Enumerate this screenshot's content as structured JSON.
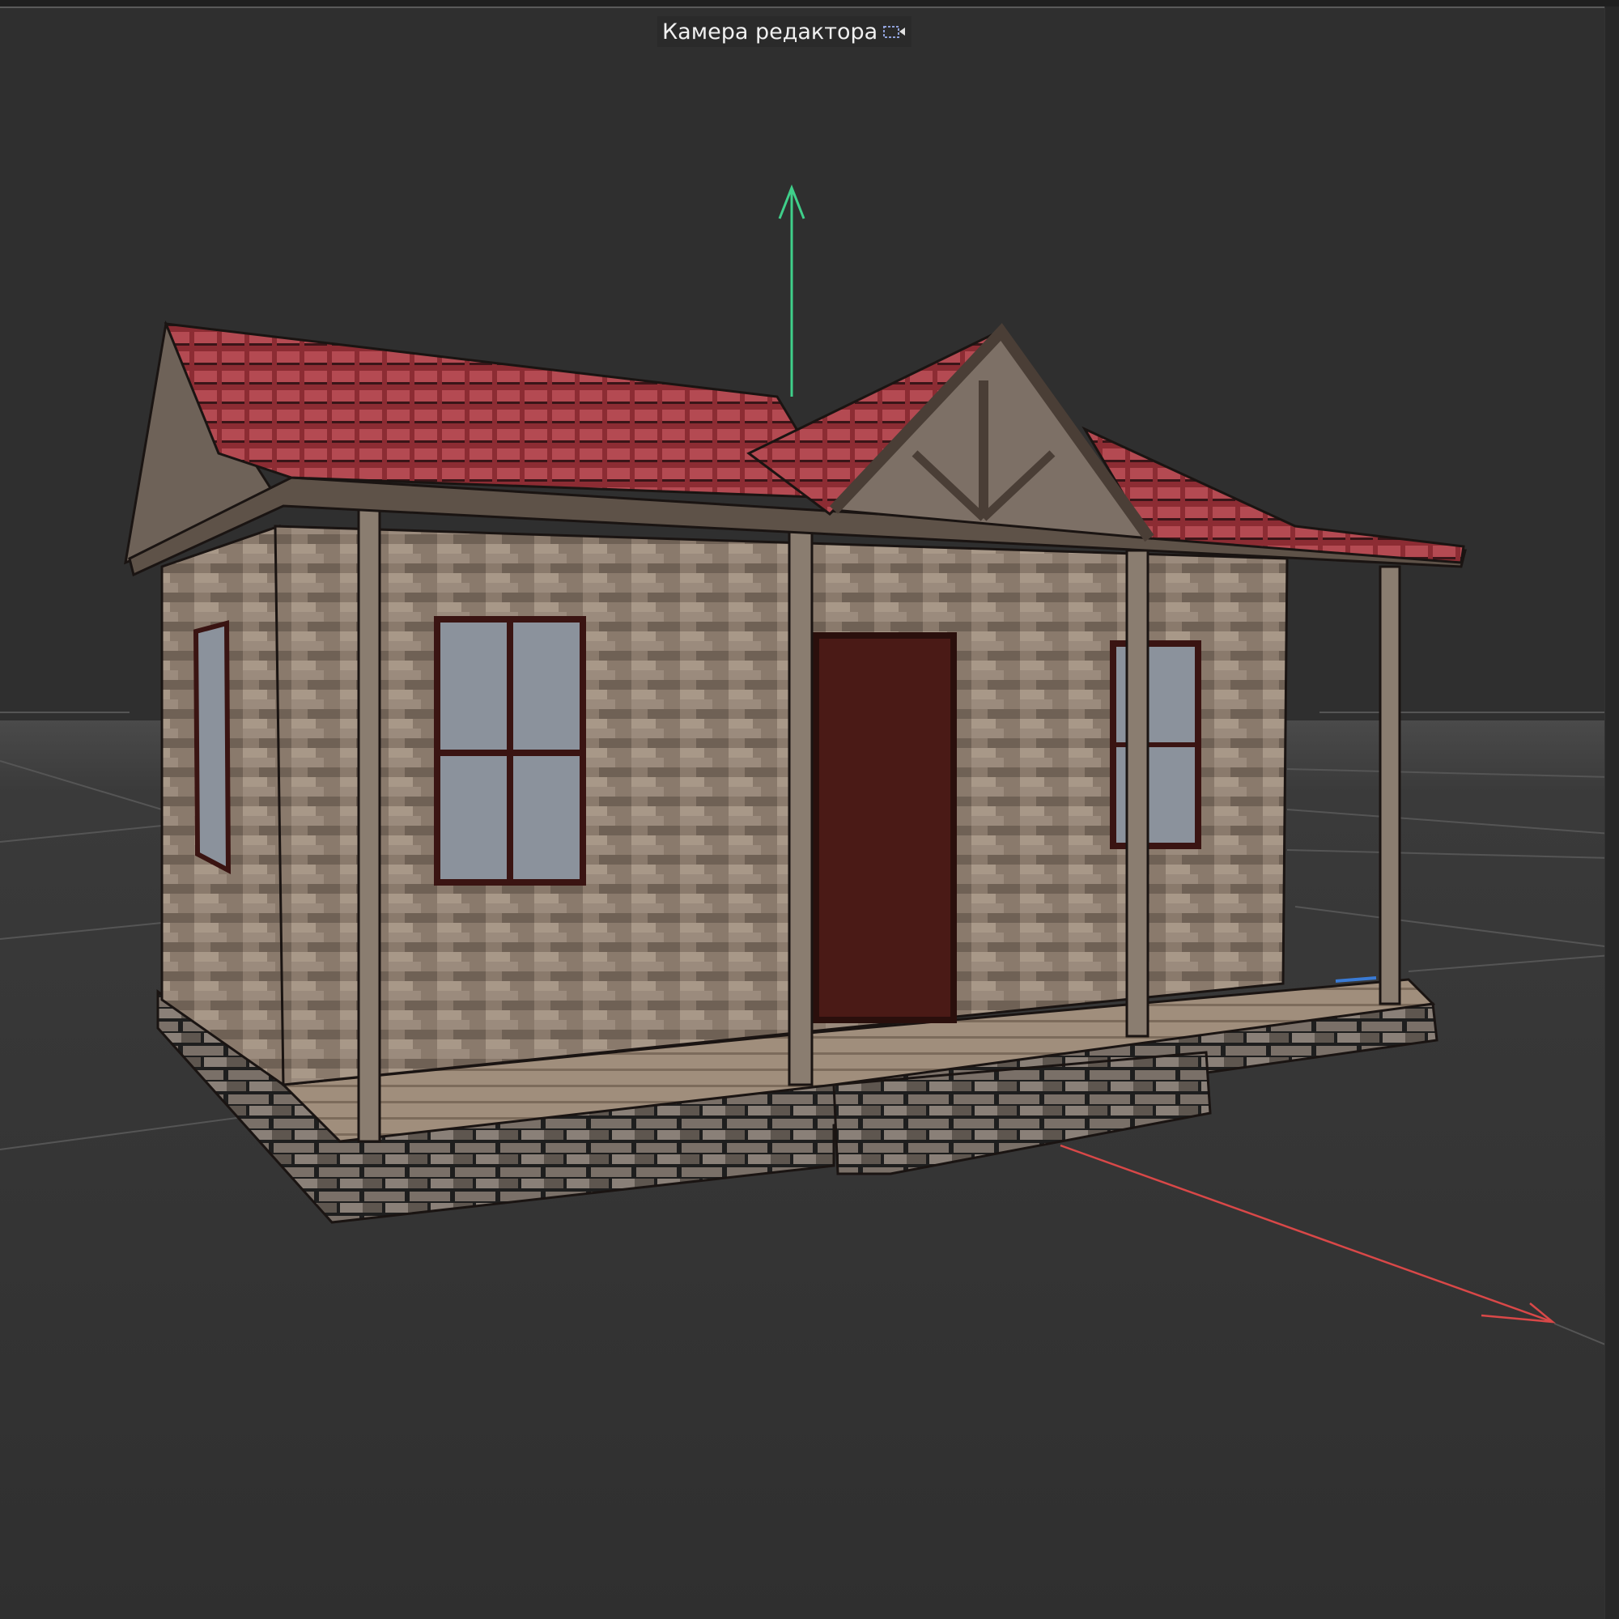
{
  "viewport": {
    "camera_label": "Камера редактора",
    "camera_icon": "camera-icon",
    "axis_colors": {
      "x": "#d94848",
      "y": "#3fcf8a",
      "z": "#3a7bd5"
    },
    "background": "#2f2f2f"
  }
}
